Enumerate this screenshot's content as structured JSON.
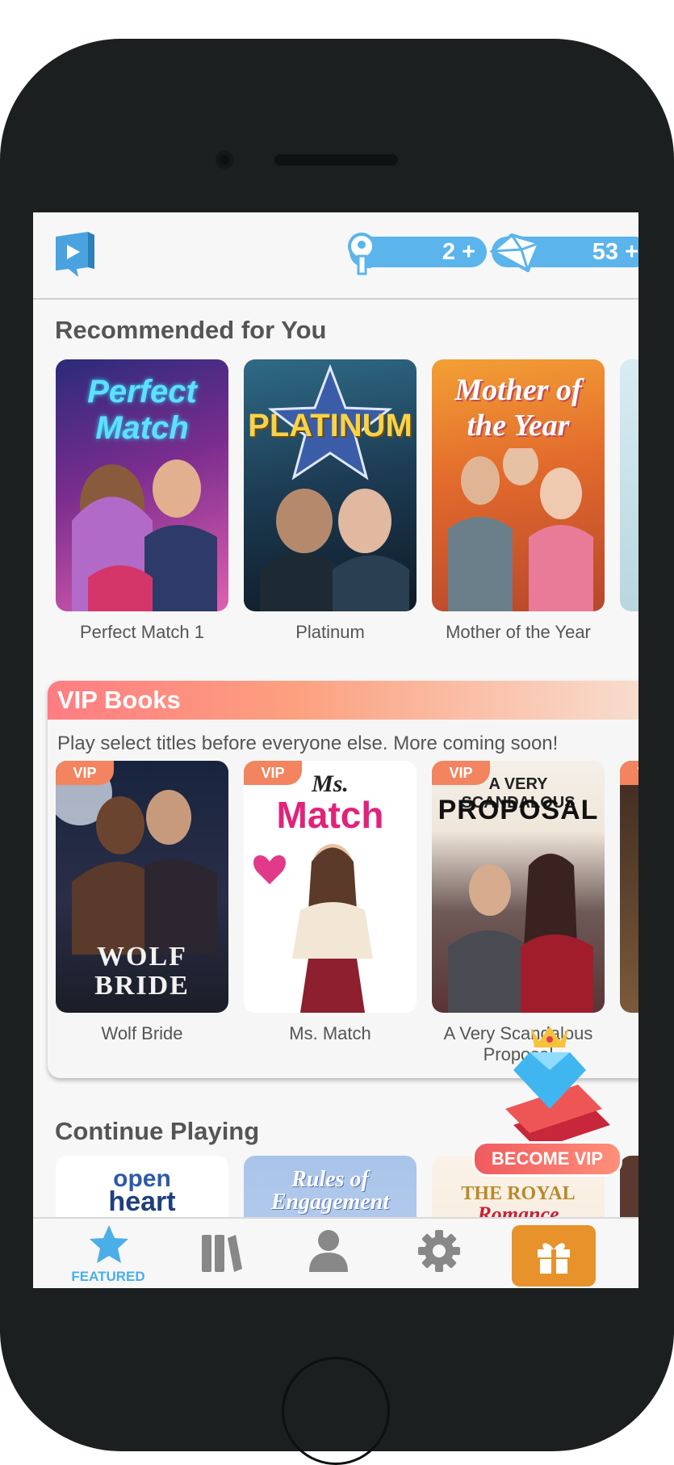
{
  "header": {
    "keys_count": "2",
    "keys_plus": "+",
    "gems_count": "53",
    "gems_plus": "+"
  },
  "recommended": {
    "title": "Recommended for You",
    "books": [
      {
        "title": "Perfect Match 1",
        "cover_text": "Perfect Match"
      },
      {
        "title": "Platinum",
        "cover_text": "PLATINUM"
      },
      {
        "title": "Mother of the Year",
        "cover_text": "Mother of the Year"
      }
    ]
  },
  "vip": {
    "title": "VIP Books",
    "subtitle": "Play select titles before everyone else. More coming soon!",
    "tag": "VIP",
    "books": [
      {
        "title": "Wolf Bride",
        "cover_text": "WOLF BRIDE"
      },
      {
        "title": "Ms. Match",
        "cover_text_top": "Ms.",
        "cover_text_bottom": "Match"
      },
      {
        "title": "A Very Scandalous Proposal",
        "cover_text_top": "A VERY SCANDALOUS",
        "cover_text_bottom": "PROPOSAL"
      }
    ]
  },
  "continue": {
    "title": "Continue Playing",
    "books": [
      {
        "cover_text_top": "open",
        "cover_text_bottom": "heart"
      },
      {
        "cover_text_top": "Rules of",
        "cover_text_bottom": "Engagement"
      },
      {
        "cover_text_top": "THE ROYAL",
        "cover_text_bottom": "Romance"
      }
    ]
  },
  "promo": {
    "label": "BECOME VIP"
  },
  "tabs": {
    "featured_label": "FEATURED"
  },
  "colors": {
    "accent_blue": "#5bb4ec",
    "gift_orange": "#e8922c",
    "vip_coral": "#f05a5f"
  }
}
